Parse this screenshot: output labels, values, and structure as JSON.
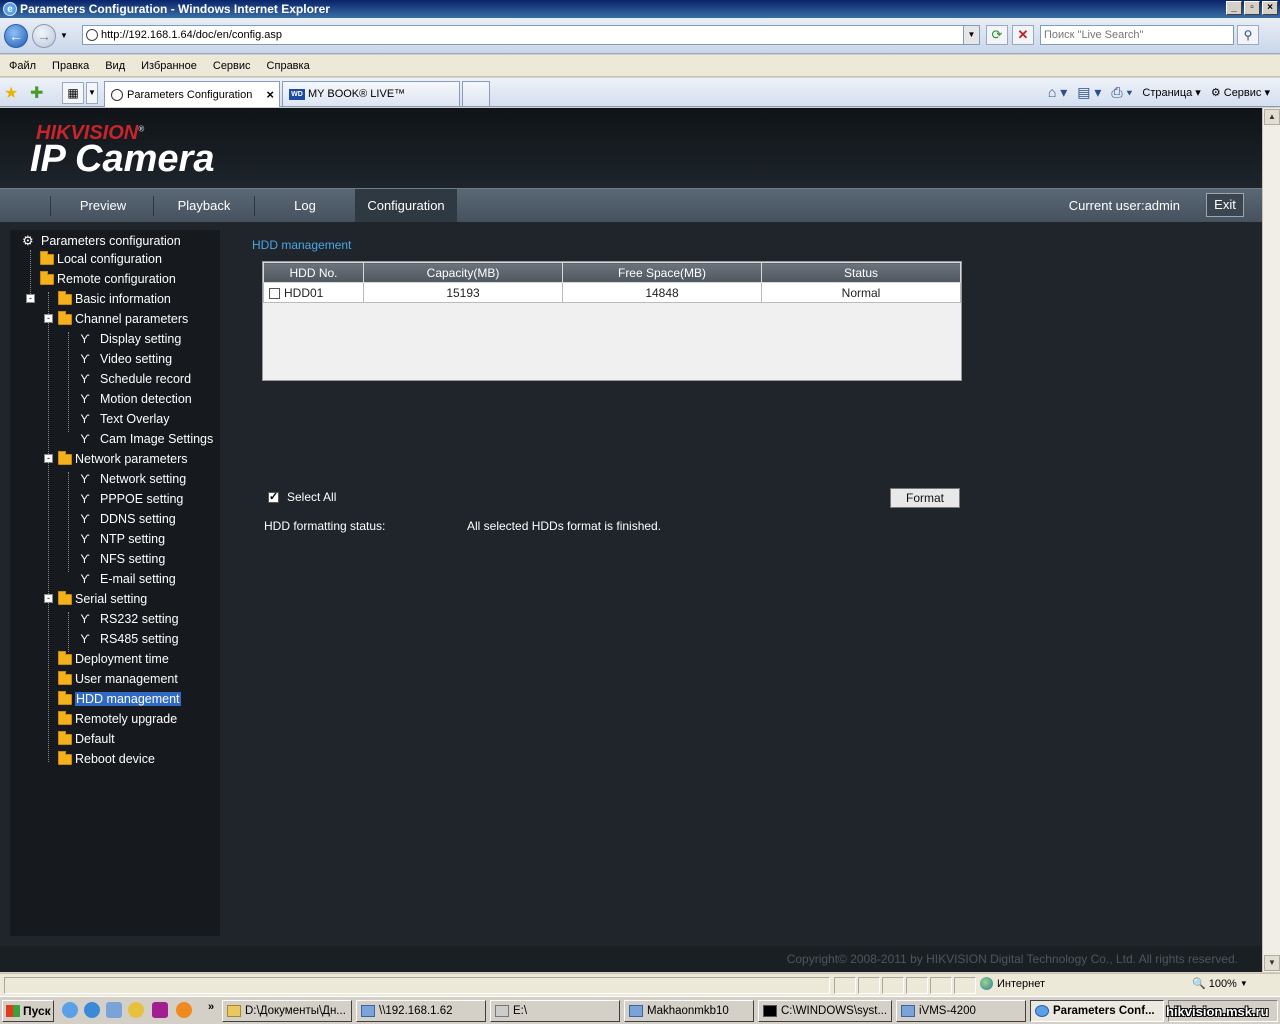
{
  "window": {
    "title": "Parameters Configuration - Windows Internet Explorer"
  },
  "addressbar": {
    "url": "http://192.168.1.64/doc/en/config.asp",
    "search_placeholder": "Поиск \"Live Search\""
  },
  "menu": [
    "Файл",
    "Правка",
    "Вид",
    "Избранное",
    "Сервис",
    "Справка"
  ],
  "tabs": [
    {
      "label": "Parameters Configuration",
      "active": true
    },
    {
      "label": "MY BOOK® LIVE™",
      "active": false
    }
  ],
  "commandbar": {
    "page_label": "Страница",
    "tools_label": "Сервис"
  },
  "brand": {
    "company": "HIKVISION",
    "product": "IP Camera",
    "trademark": "®"
  },
  "nav": {
    "tabs": [
      "Preview",
      "Playback",
      "Log",
      "Configuration"
    ],
    "current_user": "Current user:admin",
    "exit_label": "Exit"
  },
  "tree": {
    "root": "Parameters configuration",
    "items": [
      "Local configuration",
      "Remote configuration",
      "Basic information",
      "Channel parameters",
      "Display setting",
      "Video setting",
      "Schedule record",
      "Motion detection",
      "Text Overlay",
      "Cam Image Settings",
      "Network parameters",
      "Network setting",
      "PPPOE setting",
      "DDNS setting",
      "NTP setting",
      "NFS setting",
      "E-mail setting",
      "Serial setting",
      "RS232 setting",
      "RS485 setting",
      "Deployment time",
      "User management",
      "HDD management",
      "Remotely upgrade",
      "Default",
      "Reboot device"
    ]
  },
  "hdd": {
    "title": "HDD management",
    "columns": [
      "HDD No.",
      "Capacity(MB)",
      "Free Space(MB)",
      "Status"
    ],
    "rows": [
      {
        "id": "HDD01",
        "capacity": "15193",
        "free": "14848",
        "status": "Normal",
        "checked": false
      }
    ],
    "select_all_label": "Select All",
    "select_all_checked": true,
    "format_label": "Format",
    "status_label": "HDD formatting status:",
    "status_value": "All selected HDDs format is finished."
  },
  "footer": {
    "copyright": "Copyright© 2008-2011 by HIKVISION Digital Technology Co., Ltd. All rights reserved."
  },
  "statusbar": {
    "zone": "Интернет",
    "zoom": "100%"
  },
  "taskbar": {
    "start_label": "Пуск",
    "tasks": [
      "D:\\Документы\\Дн...",
      "\\\\192.168.1.62",
      "E:\\",
      "Makhaonmkb10",
      "C:\\WINDOWS\\syst...",
      "iVMS-4200",
      "Parameters Conf..."
    ],
    "watermark": "hikvision.msk.ru"
  }
}
